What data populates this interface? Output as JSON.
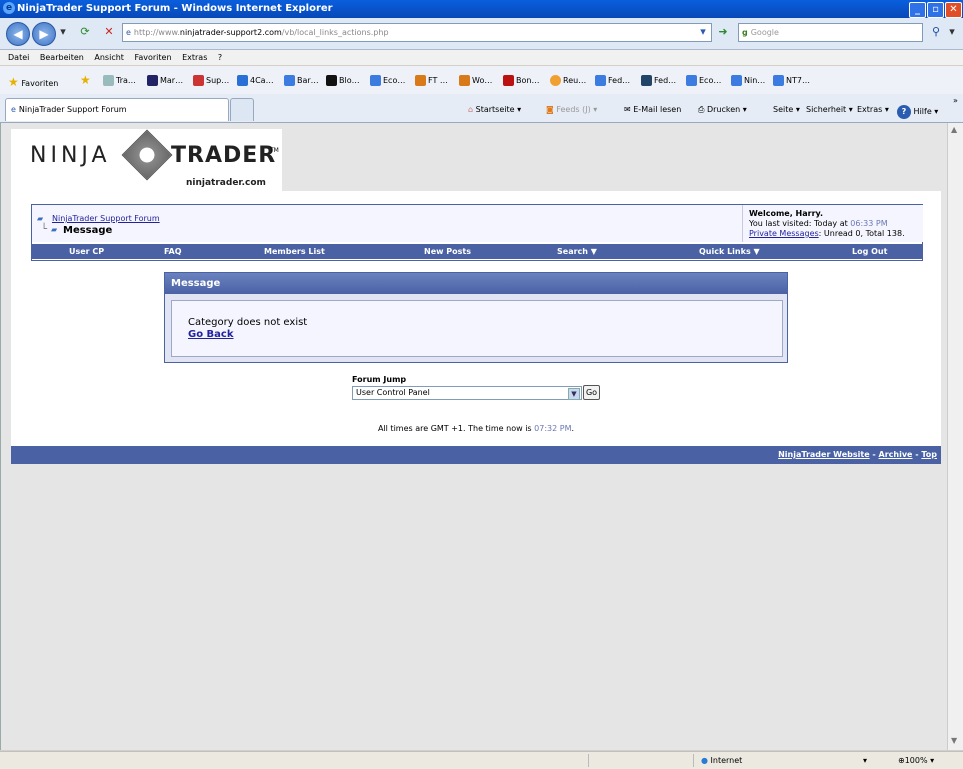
{
  "window": {
    "title": "NinjaTrader Support Forum - Windows Internet Explorer",
    "min_glyph": "_",
    "max_glyph": "▫",
    "close_glyph": "✕"
  },
  "toolbar": {
    "address_prefix": "http://www.",
    "address_host": "ninjatrader-support2.com",
    "address_path": "/vb/local_links_actions.php",
    "search_placeholder": "Google"
  },
  "menu": [
    "Datei",
    "Bearbeiten",
    "Ansicht",
    "Favoriten",
    "Extras",
    "?"
  ],
  "favorites": {
    "label": "Favoriten",
    "items": [
      "Tra…",
      "Mar…",
      "Sup…",
      "4Ca…",
      "Bar…",
      "Blo…",
      "Eco…",
      "FT …",
      "Wo…",
      "Bon…",
      "Reu…",
      "Fed…",
      "Fed…",
      "Eco…",
      "Nin…",
      "NT7…"
    ]
  },
  "tabs": {
    "active": "NinjaTrader Support Forum"
  },
  "commandbar": {
    "home": "Startseite",
    "feeds": "Feeds (J)",
    "mail": "E-Mail lesen",
    "print": "Drucken",
    "page": "Seite",
    "safety": "Sicherheit",
    "tools": "Extras",
    "help": "Hilfe"
  },
  "logo": {
    "left": "NINJA",
    "right": "TRADER",
    "tm": "TM",
    "domain": "ninjatrader.com"
  },
  "breadcrumb": {
    "forum": "NinjaTrader Support Forum",
    "current": "Message"
  },
  "welcome": {
    "greeting": "Welcome, Harry.",
    "last_visit_prefix": "You last visited: Today at",
    "last_visit_time": "06:33 PM",
    "pm_link": "Private Messages",
    "pm_stats": ": Unread 0, Total 138."
  },
  "navbar": [
    "User CP",
    "FAQ",
    "Members List",
    "New Posts",
    "Search ▼",
    "Quick Links ▼",
    "Log Out"
  ],
  "message": {
    "header": "Message",
    "text": "Category does not exist",
    "back_link": "Go Back"
  },
  "forum_jump": {
    "label": "Forum Jump",
    "selected": "User Control Panel",
    "go": "Go"
  },
  "time_line": {
    "prefix": "All times are GMT +1. The time now is",
    "time": "07:32 PM",
    "suffix": "."
  },
  "footer": {
    "website": "NinjaTrader Website",
    "archive": "Archive",
    "top": "Top"
  },
  "statusbar": {
    "zone": "Internet",
    "zoom": "100%"
  }
}
